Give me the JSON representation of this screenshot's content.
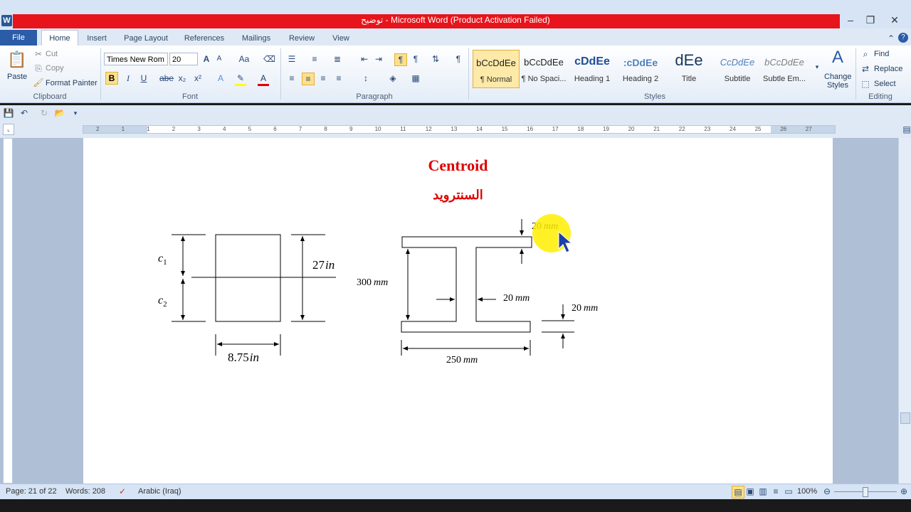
{
  "window": {
    "title": "توضيح - Microsoft Word (Product Activation Failed)",
    "app_icon": "W",
    "minimize": "–",
    "restore": "❐",
    "close": "✕"
  },
  "tabs": [
    "File",
    "Home",
    "Insert",
    "Page Layout",
    "References",
    "Mailings",
    "Review",
    "View"
  ],
  "clipboard": {
    "paste": "Paste",
    "cut": "Cut",
    "copy": "Copy",
    "format_painter": "Format Painter",
    "label": "Clipboard"
  },
  "font": {
    "name": "Times New Rom",
    "size": "20",
    "label": "Font",
    "grow": "A",
    "shrink": "A",
    "case": "Aa",
    "bold": "B",
    "italic": "I",
    "underline": "U",
    "strike": "abe",
    "subscript": "x₂",
    "superscript": "x²",
    "color_letter": "A"
  },
  "paragraph": {
    "label": "Paragraph"
  },
  "styles": {
    "label": "Styles",
    "items": [
      {
        "preview": "bCcDdEe",
        "name": "¶ Normal"
      },
      {
        "preview": "bCcDdEe",
        "name": "¶ No Spaci..."
      },
      {
        "preview": "cDdEe",
        "name": "Heading 1"
      },
      {
        "preview": ":cDdEe",
        "name": "Heading 2"
      },
      {
        "preview": "dEe",
        "name": "Title"
      },
      {
        "preview": "CcDdEe",
        "name": "Subtitle"
      },
      {
        "preview": "bCcDdEe",
        "name": "Subtle Em..."
      }
    ],
    "change_styles": "Change Styles"
  },
  "editing": {
    "label": "Editing",
    "find": "Find",
    "replace": "Replace",
    "select": "Select"
  },
  "ruler": {
    "numbers": [
      "2",
      "1",
      "1",
      "2",
      "3",
      "4",
      "5",
      "6",
      "7",
      "8",
      "9",
      "10",
      "11",
      "12",
      "13",
      "14",
      "15",
      "16",
      "17",
      "18",
      "19",
      "20",
      "21",
      "22",
      "23",
      "24",
      "25",
      "26",
      "27"
    ]
  },
  "document": {
    "title": "Centroid",
    "subtitle": "السنترويد",
    "fig1": {
      "c1": "c",
      "c1_sub": "1",
      "c2": "c",
      "c2_sub": "2",
      "height": "27",
      "height_unit": "in",
      "width": "8.75",
      "width_unit": "in"
    },
    "fig2": {
      "flange_top": "20",
      "web_height": "300",
      "web_thick": "20",
      "flange_bottom": "20",
      "width": "250",
      "unit": "mm"
    }
  },
  "status": {
    "page": "Page: 21 of 22",
    "words": "Words: 208",
    "language": "Arabic (Iraq)",
    "zoom": "100%"
  }
}
